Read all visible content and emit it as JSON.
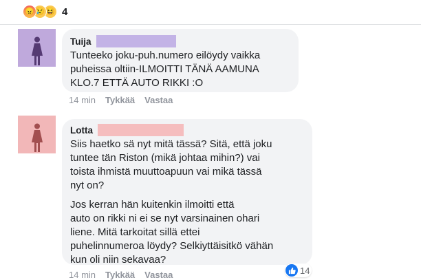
{
  "reactions": {
    "icons": [
      "angry-icon",
      "sad-icon",
      "haha-icon"
    ],
    "count": "4"
  },
  "comments": [
    {
      "author": "Tuija",
      "text": "Tunteeko joku-puh.numero eilöydy vaikka\npuheissa oltiin-ILMOITTI TÄNÄ AAMUNA\nKLO.7 ETTÄ AUTO RIKKI :O",
      "time": "14 min",
      "like_label": "Tykkää",
      "reply_label": "Vastaa",
      "avatar_color": "#bfa9dc",
      "redaction_color": "#c3b3e6"
    },
    {
      "author": "Lotta",
      "paragraphs": [
        "Siis haetko sä nyt mitä tässä? Sitä, että joku\ntuntee tän Riston (mikä johtaa mihin?) vai\ntoista ihmistä muuttoapuun vai mikä tässä\nnyt on?",
        "Jos kerran hän kuitenkin ilmoitti että\nauto on rikki ni ei se nyt varsinainen ohari\nliene. Mitä tarkoitat sillä ettei\npuhelinnumeroa löydy? Selkiyttäisitkö vähän\nkun oli niin sekavaa?"
      ],
      "time": "14 min",
      "like_label": "Tykkää",
      "reply_label": "Vastaa",
      "like_count": "14",
      "avatar_color": "#f2b7b8",
      "redaction_color": "#f5bdbe"
    }
  ],
  "colors": {
    "bubble": "#f2f3f5",
    "meta_text": "#90949c",
    "like_blue": "#1877f2"
  }
}
